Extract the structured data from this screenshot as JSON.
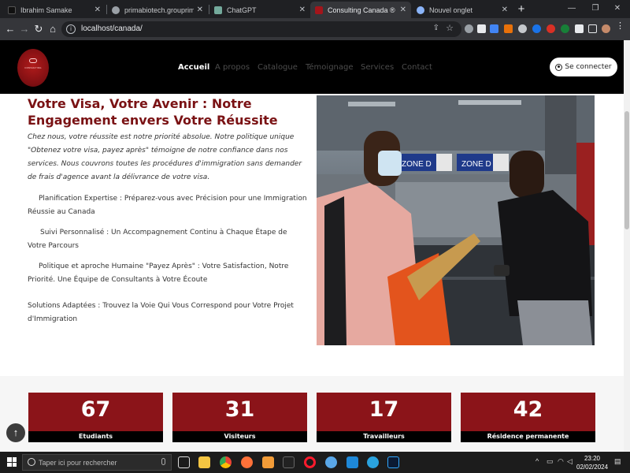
{
  "browser": {
    "tabs": [
      {
        "title": "Ibrahim Samake",
        "favicon_color": "#111111"
      },
      {
        "title": "primabiotech.grouprima.com",
        "favicon_color": "#9aa0a6"
      },
      {
        "title": "ChatGPT",
        "favicon_color": "#74aa9c"
      },
      {
        "title": "Consulting Canada ® Cabinet d",
        "favicon_color": "#a3151b"
      },
      {
        "title": "Nouvel onglet",
        "favicon_color": "#8ab4f8"
      }
    ],
    "active_tab": 3,
    "url": "localhost/canada/"
  },
  "site": {
    "nav": [
      {
        "label": "Accueil",
        "active": true
      },
      {
        "label": "A propos",
        "active": false
      },
      {
        "label": "Catalogue",
        "active": false
      },
      {
        "label": "Témoignage",
        "active": false
      },
      {
        "label": "Services",
        "active": false
      },
      {
        "label": "Contact",
        "active": false
      }
    ],
    "login_label": "Se connecter"
  },
  "content": {
    "headline": "Votre Visa, Votre Avenir : Notre Engagement envers Votre Réussite",
    "intro": "Chez nous, votre réussite est notre priorité absolue. Notre politique unique \"Obtenez votre visa, payez après\" témoigne de notre confiance dans nos services. Nous couvrons toutes les procédures d'immigration sans demander de frais d'agence avant la délivrance de votre visa.",
    "points": [
      "Planification Expertise : Préparez-vous avec Précision pour une Immigration Réussie au Canada",
      "Suivi Personnalisé : Un Accompagnement Continu à Chaque Étape de Votre Parcours",
      "Politique et aproche Humaine \"Payez Après\" : Votre Satisfaction, Notre Priorité. Une Équipe de Consultants à Votre Écoute",
      "Solutions Adaptées : Trouvez la Voie Qui Vous Correspond pour Votre Projet d'Immigration"
    ],
    "photo_signs": [
      "ZONE D",
      "ZONE D"
    ]
  },
  "stats": [
    {
      "value": "67",
      "label": "Etudiants"
    },
    {
      "value": "31",
      "label": "Visiteurs"
    },
    {
      "value": "17",
      "label": "Travailleurs"
    },
    {
      "value": "42",
      "label": "Résidence permanente"
    }
  ],
  "taskbar": {
    "search_placeholder": "Taper ici pour rechercher",
    "time": "23:20",
    "date": "02/02/2024"
  },
  "colors": {
    "brand_red": "#8b1419",
    "headline_red": "#7a1214",
    "header_bg": "#000000"
  }
}
